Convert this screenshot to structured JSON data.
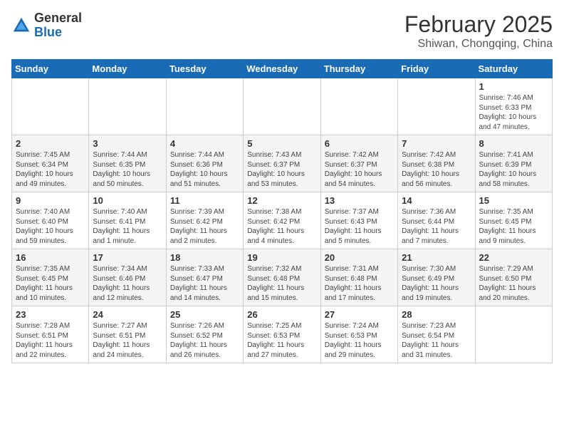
{
  "header": {
    "logo_general": "General",
    "logo_blue": "Blue",
    "month_title": "February 2025",
    "location": "Shiwan, Chongqing, China"
  },
  "weekdays": [
    "Sunday",
    "Monday",
    "Tuesday",
    "Wednesday",
    "Thursday",
    "Friday",
    "Saturday"
  ],
  "weeks": [
    [
      {
        "day": "",
        "info": ""
      },
      {
        "day": "",
        "info": ""
      },
      {
        "day": "",
        "info": ""
      },
      {
        "day": "",
        "info": ""
      },
      {
        "day": "",
        "info": ""
      },
      {
        "day": "",
        "info": ""
      },
      {
        "day": "1",
        "info": "Sunrise: 7:46 AM\nSunset: 6:33 PM\nDaylight: 10 hours\nand 47 minutes."
      }
    ],
    [
      {
        "day": "2",
        "info": "Sunrise: 7:45 AM\nSunset: 6:34 PM\nDaylight: 10 hours\nand 49 minutes."
      },
      {
        "day": "3",
        "info": "Sunrise: 7:44 AM\nSunset: 6:35 PM\nDaylight: 10 hours\nand 50 minutes."
      },
      {
        "day": "4",
        "info": "Sunrise: 7:44 AM\nSunset: 6:36 PM\nDaylight: 10 hours\nand 51 minutes."
      },
      {
        "day": "5",
        "info": "Sunrise: 7:43 AM\nSunset: 6:37 PM\nDaylight: 10 hours\nand 53 minutes."
      },
      {
        "day": "6",
        "info": "Sunrise: 7:42 AM\nSunset: 6:37 PM\nDaylight: 10 hours\nand 54 minutes."
      },
      {
        "day": "7",
        "info": "Sunrise: 7:42 AM\nSunset: 6:38 PM\nDaylight: 10 hours\nand 56 minutes."
      },
      {
        "day": "8",
        "info": "Sunrise: 7:41 AM\nSunset: 6:39 PM\nDaylight: 10 hours\nand 58 minutes."
      }
    ],
    [
      {
        "day": "9",
        "info": "Sunrise: 7:40 AM\nSunset: 6:40 PM\nDaylight: 10 hours\nand 59 minutes."
      },
      {
        "day": "10",
        "info": "Sunrise: 7:40 AM\nSunset: 6:41 PM\nDaylight: 11 hours\nand 1 minute."
      },
      {
        "day": "11",
        "info": "Sunrise: 7:39 AM\nSunset: 6:42 PM\nDaylight: 11 hours\nand 2 minutes."
      },
      {
        "day": "12",
        "info": "Sunrise: 7:38 AM\nSunset: 6:42 PM\nDaylight: 11 hours\nand 4 minutes."
      },
      {
        "day": "13",
        "info": "Sunrise: 7:37 AM\nSunset: 6:43 PM\nDaylight: 11 hours\nand 5 minutes."
      },
      {
        "day": "14",
        "info": "Sunrise: 7:36 AM\nSunset: 6:44 PM\nDaylight: 11 hours\nand 7 minutes."
      },
      {
        "day": "15",
        "info": "Sunrise: 7:35 AM\nSunset: 6:45 PM\nDaylight: 11 hours\nand 9 minutes."
      }
    ],
    [
      {
        "day": "16",
        "info": "Sunrise: 7:35 AM\nSunset: 6:45 PM\nDaylight: 11 hours\nand 10 minutes."
      },
      {
        "day": "17",
        "info": "Sunrise: 7:34 AM\nSunset: 6:46 PM\nDaylight: 11 hours\nand 12 minutes."
      },
      {
        "day": "18",
        "info": "Sunrise: 7:33 AM\nSunset: 6:47 PM\nDaylight: 11 hours\nand 14 minutes."
      },
      {
        "day": "19",
        "info": "Sunrise: 7:32 AM\nSunset: 6:48 PM\nDaylight: 11 hours\nand 15 minutes."
      },
      {
        "day": "20",
        "info": "Sunrise: 7:31 AM\nSunset: 6:48 PM\nDaylight: 11 hours\nand 17 minutes."
      },
      {
        "day": "21",
        "info": "Sunrise: 7:30 AM\nSunset: 6:49 PM\nDaylight: 11 hours\nand 19 minutes."
      },
      {
        "day": "22",
        "info": "Sunrise: 7:29 AM\nSunset: 6:50 PM\nDaylight: 11 hours\nand 20 minutes."
      }
    ],
    [
      {
        "day": "23",
        "info": "Sunrise: 7:28 AM\nSunset: 6:51 PM\nDaylight: 11 hours\nand 22 minutes."
      },
      {
        "day": "24",
        "info": "Sunrise: 7:27 AM\nSunset: 6:51 PM\nDaylight: 11 hours\nand 24 minutes."
      },
      {
        "day": "25",
        "info": "Sunrise: 7:26 AM\nSunset: 6:52 PM\nDaylight: 11 hours\nand 26 minutes."
      },
      {
        "day": "26",
        "info": "Sunrise: 7:25 AM\nSunset: 6:53 PM\nDaylight: 11 hours\nand 27 minutes."
      },
      {
        "day": "27",
        "info": "Sunrise: 7:24 AM\nSunset: 6:53 PM\nDaylight: 11 hours\nand 29 minutes."
      },
      {
        "day": "28",
        "info": "Sunrise: 7:23 AM\nSunset: 6:54 PM\nDaylight: 11 hours\nand 31 minutes."
      },
      {
        "day": "",
        "info": ""
      }
    ]
  ]
}
